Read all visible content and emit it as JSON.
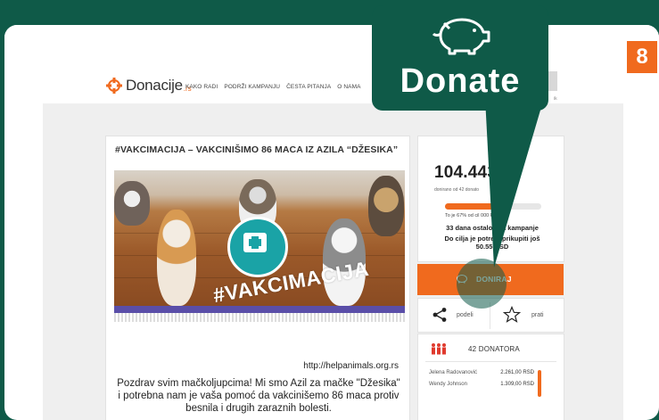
{
  "step_badge": "8",
  "site": {
    "logo_text": "Donacije",
    "logo_suffix": ".rs",
    "nav": [
      "KAKO RADI",
      "PODRŽI KAMPANJU",
      "ČESTA PITANJA",
      "O NAMA"
    ],
    "user_label": "ik"
  },
  "campaign": {
    "title": "#VAKCIMACIJA – VAKCINIŠIMO 86 MACA IZ AZILA “DŽESIKA”",
    "image_text": "#VAKCIMACIJA",
    "url": "http://helpanimals.org.rs",
    "description": "Pozdrav svim mačkoljupcima! Mi smo Azil za mačke \"Džesika\" i potrebna nam je vaša pomoć da vakcinišemo 86 maca protiv besnila i drugih zaraznih bolesti."
  },
  "stats": {
    "amount": "104.443",
    "amount_sub": "donirano od 42 donato",
    "progress_percent": 67,
    "progress_label": "To je 67% od cil        000 RSD",
    "days_left": "33 dana ostalo d      ja kampanje",
    "goal_line1": "Do cilja je potre      o prikupiti još",
    "goal_line2": "50.55    RSD"
  },
  "donate_button": {
    "label": "DONIRAJ"
  },
  "share": {
    "share_label": "podeli",
    "follow_label": "prati"
  },
  "donors": {
    "count_label": "42 DONATORA",
    "rows": [
      {
        "name": "Jelena Radovanović",
        "amount": "2.261,00 RSD"
      },
      {
        "name": "Wendy Johnson",
        "amount": "1.309,00 RSD"
      }
    ]
  },
  "callout": {
    "label": "Donate",
    "icon": "piggy-bank-icon"
  },
  "colors": {
    "brand_orange": "#f06a1e",
    "overlay_green": "#0f5a48",
    "teal": "#1aa3a6"
  }
}
